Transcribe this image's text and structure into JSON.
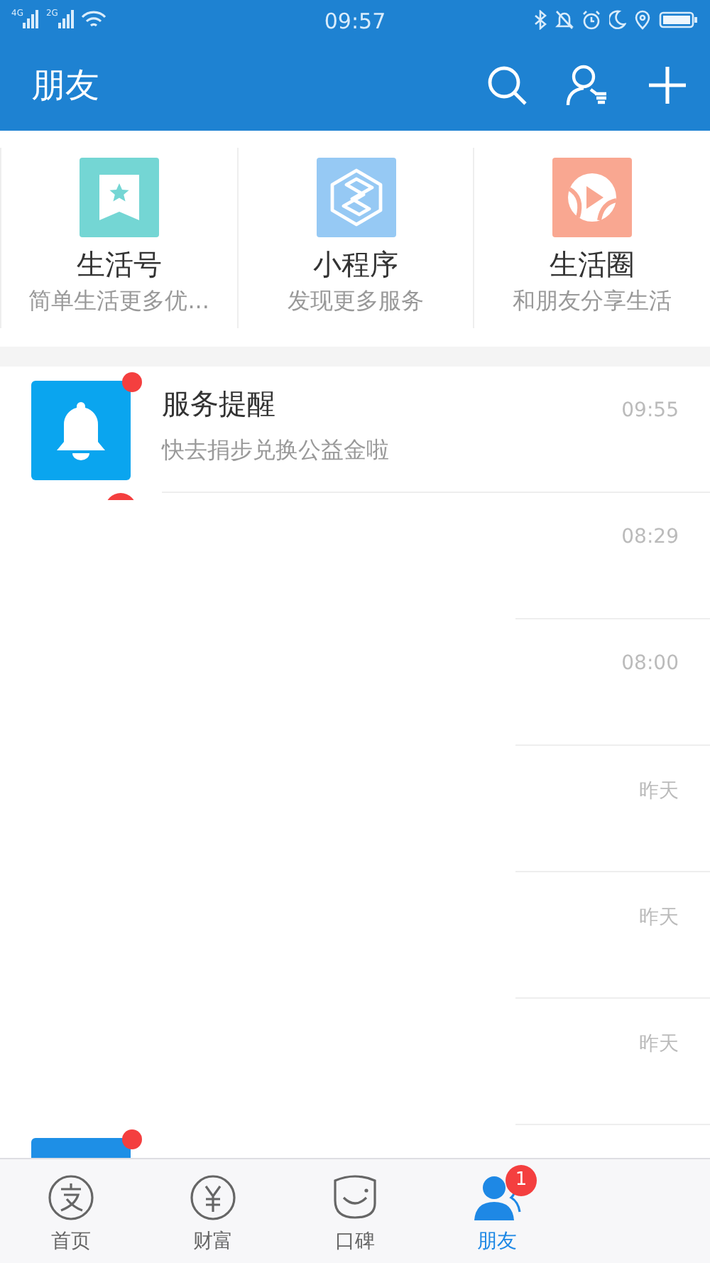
{
  "status_bar": {
    "network_1": "4G",
    "network_2": "2G",
    "time": "09:57"
  },
  "header": {
    "title": "朋友"
  },
  "shortcuts": [
    {
      "kind": "bookmark",
      "color": "#74d6d4",
      "title": "生活号",
      "subtitle": "简单生活更多优..."
    },
    {
      "kind": "hexagon",
      "color": "#96c9f4",
      "title": "小程序",
      "subtitle": "发现更多服务"
    },
    {
      "kind": "play",
      "color": "#f9a791",
      "title": "生活圈",
      "subtitle": "和朋友分享生活"
    }
  ],
  "messages": [
    {
      "kind": "message",
      "title": "服务提醒",
      "preview": "快去捐步兑换公益金啦",
      "time": "09:55",
      "unread": true
    },
    {
      "kind": "blank",
      "time": "08:29",
      "unread": true
    },
    {
      "kind": "blank",
      "time": "08:00",
      "unread": false
    },
    {
      "kind": "blank",
      "time": "昨天",
      "unread": false
    },
    {
      "kind": "blank",
      "time": "昨天",
      "unread": false
    },
    {
      "kind": "blank",
      "time": "昨天",
      "unread": false
    },
    {
      "kind": "cut",
      "unread": true
    }
  ],
  "tabs": [
    {
      "kind": "home",
      "label": "首页",
      "selected": false
    },
    {
      "kind": "wealth",
      "label": "财富",
      "selected": false
    },
    {
      "kind": "koubei",
      "label": "口碑",
      "selected": false
    },
    {
      "kind": "friends",
      "label": "朋友",
      "selected": true,
      "badge": "1"
    }
  ]
}
